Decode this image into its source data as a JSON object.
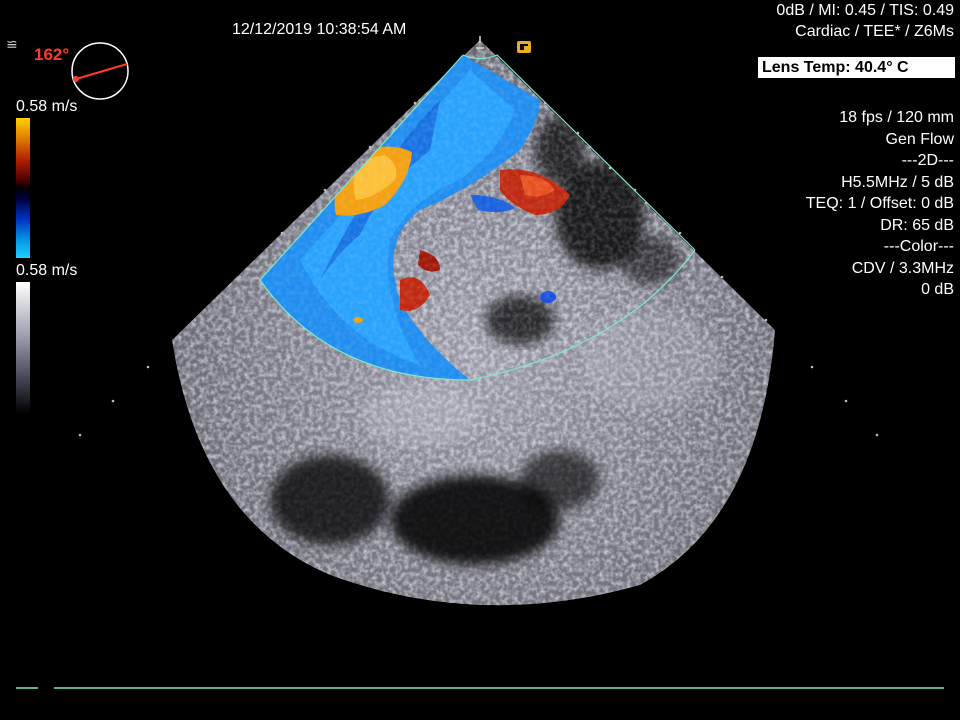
{
  "header": {
    "datetime": "12/12/2019 10:38:54 AM",
    "acoustic_line": "0dB / MI: 0.45 / TIS: 0.49",
    "preset_line": "Cardiac / TEE* / Z6Ms",
    "lens_temp": "Lens Temp: 40.4° C"
  },
  "params": [
    "18 fps / 120 mm",
    "Gen Flow",
    "---2D---",
    "H5.5MHz / 5 dB",
    "TEQ: 1 / Offset: 0 dB",
    "DR: 65 dB",
    "---Color---",
    "CDV / 3.3MHz",
    "0 dB"
  ],
  "probe": {
    "angle_label": "162°",
    "angle_degrees": 162
  },
  "scales": {
    "color_velocity_top": "0.58 m/s",
    "gray_velocity_top": "0.58 m/s"
  },
  "icons": {
    "menu": "menu-lines-icon",
    "orientation_marker": "orientation-marker-icon"
  },
  "colors": {
    "angle_accent": "#ff3a2a",
    "sector_outline": "#7fe8c8",
    "marker": "#e8b020"
  }
}
